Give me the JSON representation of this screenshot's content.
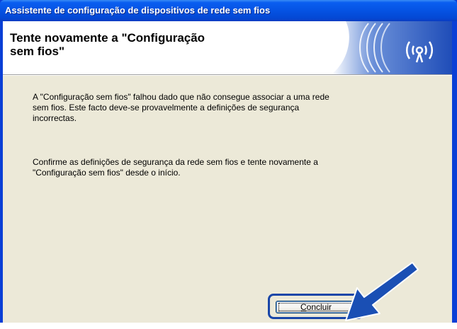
{
  "window": {
    "title": "Assistente de configuração de dispositivos de rede sem fios"
  },
  "banner": {
    "title_line1": "Tente novamente a \"Configuração",
    "title_line2": "sem fios\""
  },
  "body": {
    "paragraph1_line1": "A \"Configuração sem fios\" falhou dado que não consegue associar a uma rede",
    "paragraph1_line2": "sem fios. Este facto deve-se provavelmente a definições de segurança",
    "paragraph1_line3": "incorrectas.",
    "paragraph2_line1": "Confirme as definições de segurança da rede sem fios e tente  novamente a",
    "paragraph2_line2": "\"Configuração sem fios\" desde o início."
  },
  "buttons": {
    "finish_first_letter": "C",
    "finish_rest": "oncluir"
  },
  "colors": {
    "titlebar": "#0553e3",
    "dialog_bg": "#ece9d8",
    "arrow": "#1a4fb4",
    "highlight_border": "#1946a8"
  },
  "icons": {
    "banner": "wireless-signal-icon",
    "pointer": "arrow-pointer-icon"
  }
}
